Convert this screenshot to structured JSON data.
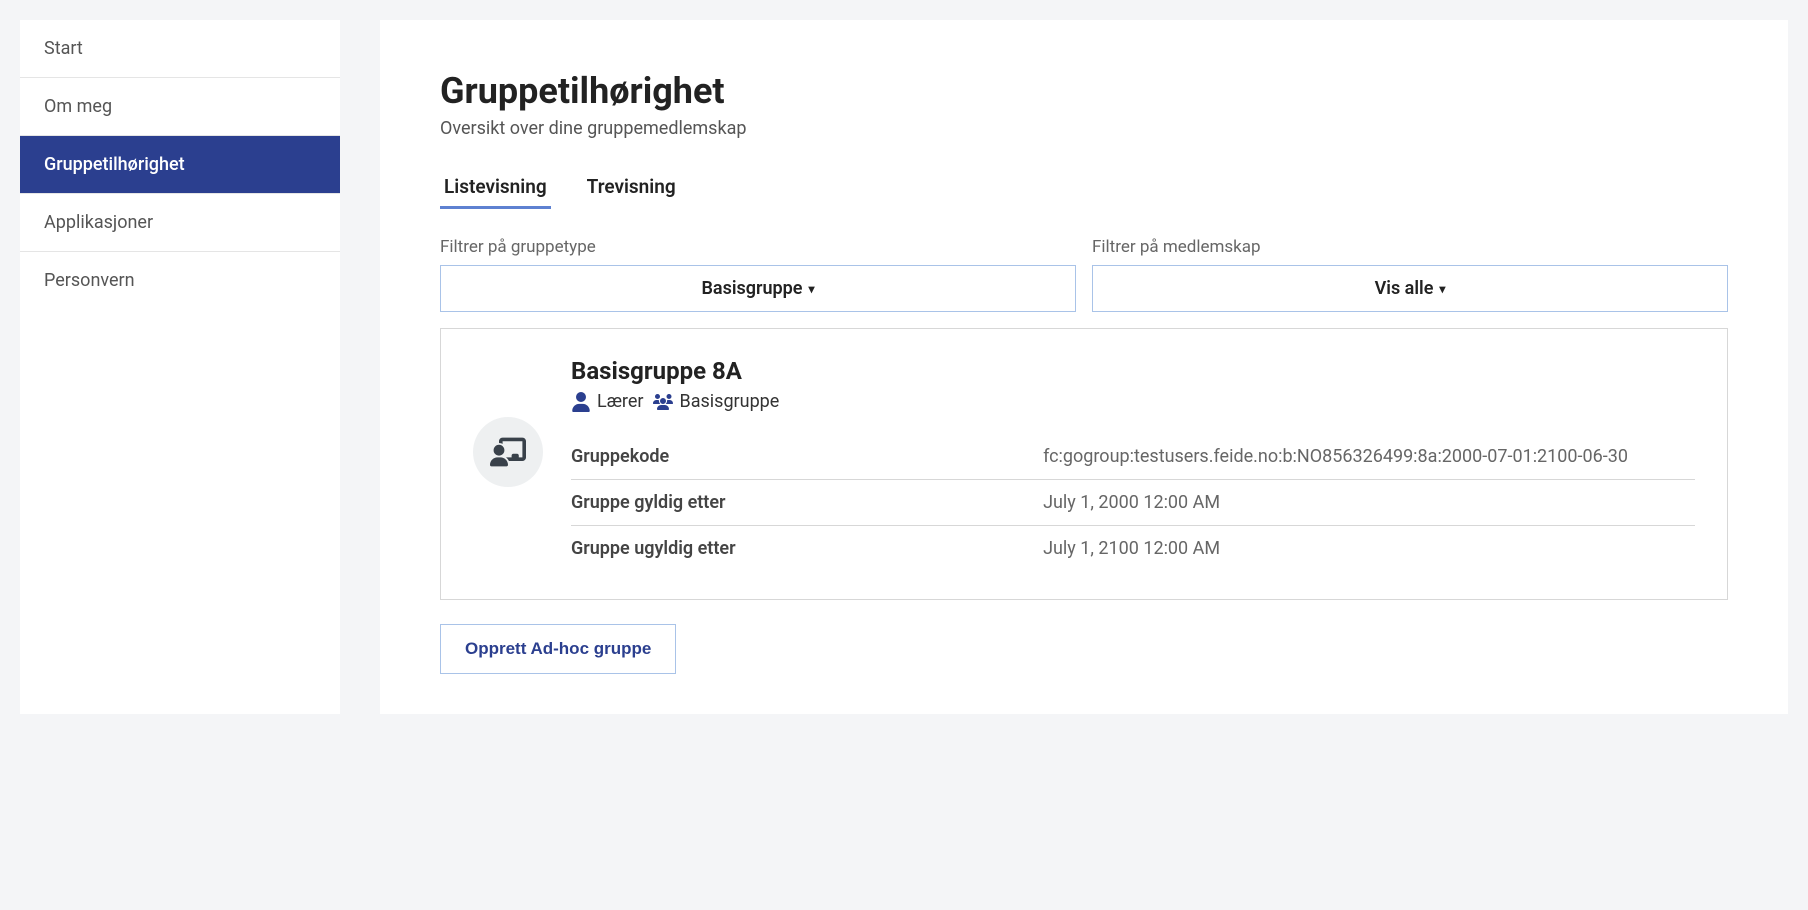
{
  "sidebar": {
    "items": [
      {
        "label": "Start",
        "active": false
      },
      {
        "label": "Om meg",
        "active": false
      },
      {
        "label": "Gruppetilhørighet",
        "active": true
      },
      {
        "label": "Applikasjoner",
        "active": false
      },
      {
        "label": "Personvern",
        "active": false
      }
    ]
  },
  "page": {
    "title": "Gruppetilhørighet",
    "subtitle": "Oversikt over dine gruppemedlemskap"
  },
  "tabs": [
    {
      "label": "Listevisning",
      "active": true
    },
    {
      "label": "Trevisning",
      "active": false
    }
  ],
  "filters": {
    "grouptype": {
      "label": "Filtrer på gruppetype",
      "selected": "Basisgruppe"
    },
    "membership": {
      "label": "Filtrer på medlemskap",
      "selected": "Vis alle"
    }
  },
  "group": {
    "name": "Basisgruppe 8A",
    "role": "Lærer",
    "type": "Basisgruppe",
    "details": [
      {
        "label": "Gruppekode",
        "value": "fc:gogroup:testusers.feide.no:b:NO856326499:8a:2000-07-01:2100-06-30"
      },
      {
        "label": "Gruppe gyldig etter",
        "value": "July 1, 2000 12:00 AM"
      },
      {
        "label": "Gruppe ugyldig etter",
        "value": "July 1, 2100 12:00 AM"
      }
    ]
  },
  "actions": {
    "create_adhoc": "Opprett Ad-hoc gruppe"
  }
}
